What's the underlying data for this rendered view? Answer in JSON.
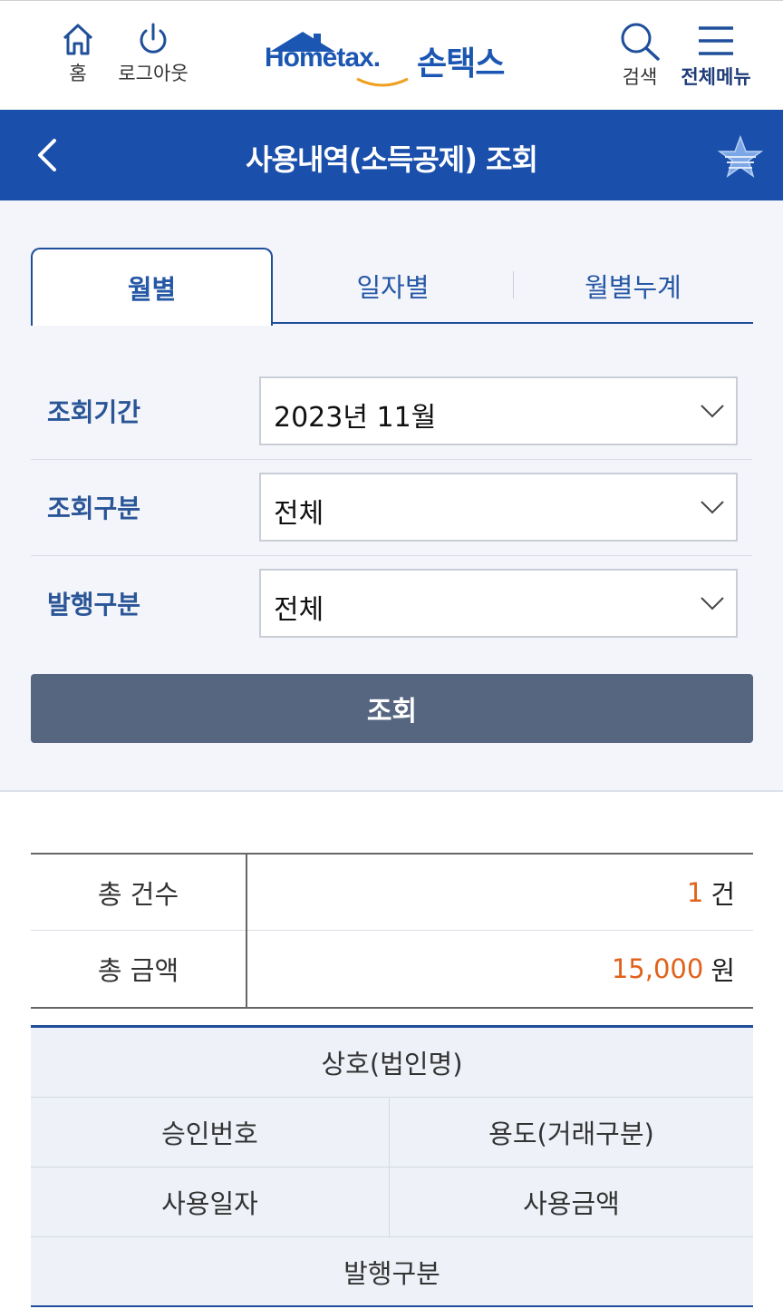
{
  "header": {
    "home_label": "홈",
    "logout_label": "로그아웃",
    "logo_hometax": "Hometax.",
    "logo_korean": "손택스",
    "search_label": "검색",
    "menu_label": "전체메뉴"
  },
  "titlebar": {
    "title": "사용내역(소득공제) 조회"
  },
  "tabs": [
    {
      "label": "월별",
      "active": true
    },
    {
      "label": "일자별",
      "active": false
    },
    {
      "label": "월별누계",
      "active": false
    }
  ],
  "form": {
    "period": {
      "label": "조회기간",
      "value": "2023년 11월"
    },
    "type": {
      "label": "조회구분",
      "value": "전체"
    },
    "issue": {
      "label": "발행구분",
      "value": "전체"
    },
    "submit_label": "조회"
  },
  "summary": {
    "count_label": "총 건수",
    "count_value": "1",
    "count_unit": "건",
    "amount_label": "총 금액",
    "amount_value": "15,000",
    "amount_unit": "원"
  },
  "detail_headers": {
    "company": "상호(법인명)",
    "approval_no": "승인번호",
    "usage": "용도(거래구분)",
    "use_date": "사용일자",
    "use_amount": "사용금액",
    "issue_type": "발행구분"
  },
  "colors": {
    "brand_blue": "#1a4fab",
    "button_gray": "#566681",
    "amount_orange": "#e0621c"
  }
}
